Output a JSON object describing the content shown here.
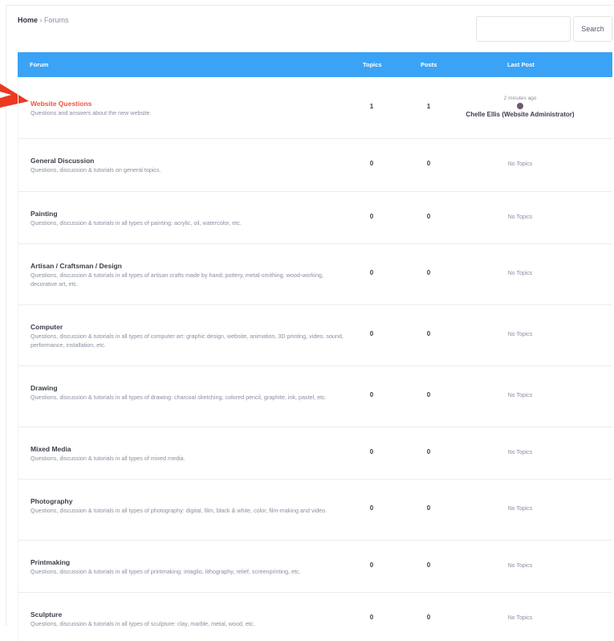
{
  "breadcrumb": {
    "home": "Home",
    "separator": "›",
    "current": "Forums"
  },
  "search": {
    "button_label": "Search",
    "placeholder": ""
  },
  "table": {
    "headers": {
      "forum": "Forum",
      "topics": "Topics",
      "posts": "Posts",
      "last_post": "Last Post"
    },
    "rows": [
      {
        "title": "Website Questions",
        "description": "Questions and answers about the new website.",
        "topics": "1",
        "posts": "1",
        "last_post_time": "2 minutes ago",
        "last_post_author": "Chelle Ellis (Website Administrator)"
      },
      {
        "title": "General Discussion",
        "description": "Questions, discussion & tutorials on general topics.",
        "topics": "0",
        "posts": "0",
        "last_post": "No Topics"
      },
      {
        "title": "Painting",
        "description": "Questions, discussion & tutorials in all types of painting:  acrylic, oil, watercolor, etc.",
        "topics": "0",
        "posts": "0",
        "last_post": "No Topics"
      },
      {
        "title": "Artisan / Craftsman / Design",
        "description": "Questions, discussion & tutorials in all types of artisan crafts made by hand;  pottery, metal-smithing, wood-working, decorative art, etc.",
        "topics": "0",
        "posts": "0",
        "last_post": "No Topics"
      },
      {
        "title": "Computer",
        "description": "Questions, discussion & tutorials in all types of computer art:  graphic design, website, animation, 3D printing, video, sound, performance, installation, etc.",
        "topics": "0",
        "posts": "0",
        "last_post": "No Topics"
      },
      {
        "title": "Drawing",
        "description": "Questions, discussion & tutorials in all types of drawing:  charcoal sketching, colored pencil, graphite, ink, pastel, etc.",
        "topics": "0",
        "posts": "0",
        "last_post": "No Topics"
      },
      {
        "title": "Mixed Media",
        "description": "Questions, discussion & tutorials in all types of mixed media.",
        "topics": "0",
        "posts": "0",
        "last_post": "No Topics"
      },
      {
        "title": "Photography",
        "description": "Questions, discussion & tutorials in all types of photography:  digital, film, black & white, color, film-making and video.",
        "topics": "0",
        "posts": "0",
        "last_post": "No Topics"
      },
      {
        "title": "Printmaking",
        "description": "Questions, discussion & tutorials in all types of printmaking:  intaglio, lithography, relief, screenprinting, etc.",
        "topics": "0",
        "posts": "0",
        "last_post": "No Topics"
      },
      {
        "title": "Sculpture",
        "description": "Questions, discussion & tutorials in all types of sculpture:  clay, marble, metal, wood, etc.",
        "topics": "0",
        "posts": "0",
        "last_post": "No Topics"
      }
    ]
  },
  "colors": {
    "header_bg": "#3aa3f6",
    "active_title": "#f0533c",
    "arrow": "#ea3a22"
  },
  "icons": {
    "annotation_arrow": "red-arrow-icon",
    "author_avatar": "avatar-icon"
  }
}
